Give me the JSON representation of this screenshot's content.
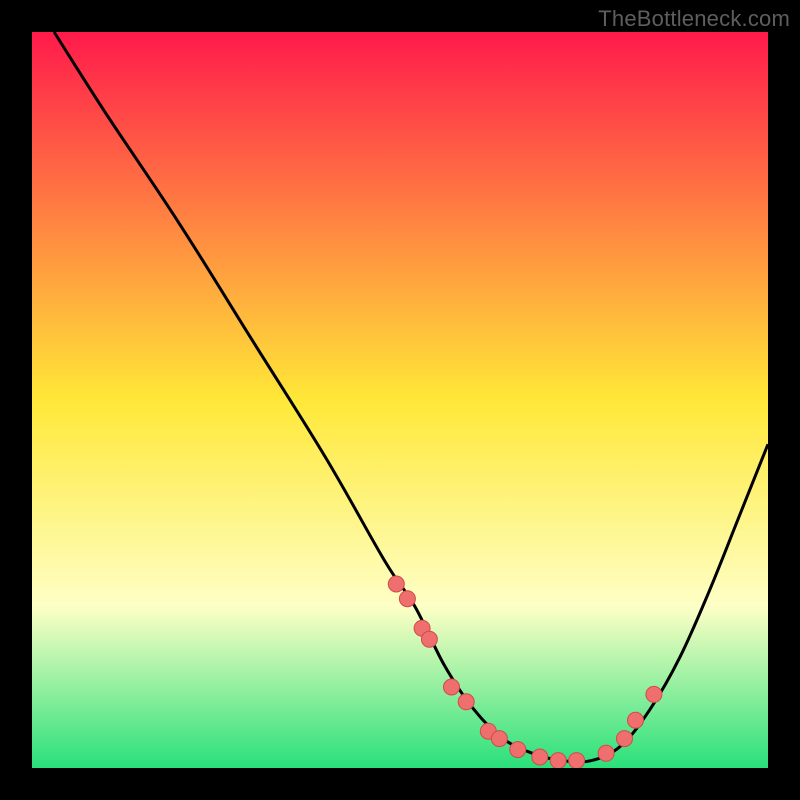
{
  "watermark": "TheBottleneck.com",
  "colors": {
    "bg": "#000000",
    "grad_top": "#ff1a4b",
    "grad_mid": "#ffe838",
    "grad_pale": "#feffc6",
    "grad_bottom": "#29e07a",
    "curve": "#000000",
    "dot_fill": "#ef6e6e",
    "dot_stroke": "#d24a4a"
  },
  "chart_data": {
    "type": "line",
    "title": "",
    "xlabel": "",
    "ylabel": "",
    "xlim": [
      0,
      100
    ],
    "ylim": [
      0,
      100
    ],
    "curve": {
      "name": "bottleneck-curve",
      "x": [
        3,
        10,
        20,
        30,
        40,
        48,
        52,
        56,
        60,
        64,
        68,
        72,
        76,
        80,
        84,
        88,
        92,
        96,
        100
      ],
      "y": [
        100,
        89,
        74,
        58,
        42,
        28,
        22,
        14,
        8,
        4,
        2,
        1,
        1,
        3,
        8,
        15,
        24,
        34,
        44
      ]
    },
    "dots": {
      "name": "highlight-points",
      "x": [
        49.5,
        51,
        53,
        54,
        57,
        59,
        62,
        63.5,
        66,
        69,
        71.5,
        74,
        78,
        80.5,
        82,
        84.5
      ],
      "y": [
        25,
        23,
        19,
        17.5,
        11,
        9,
        5,
        4,
        2.5,
        1.5,
        1,
        1,
        2,
        4,
        6.5,
        10
      ]
    }
  }
}
